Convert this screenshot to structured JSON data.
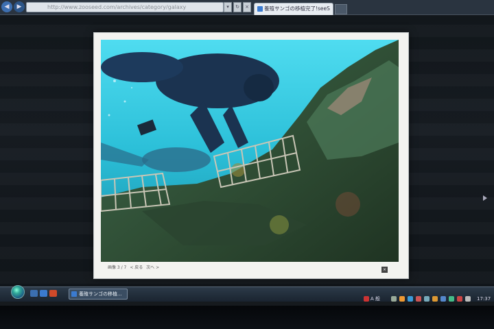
{
  "browser": {
    "address": "http://www.zooseed.com/archives/category/galaxy",
    "back_icon": "back-arrow-icon",
    "forward_icon": "forward-arrow-icon",
    "refresh_label": "↻",
    "stop_label": "×",
    "tab_title": "養殖サンゴの移植完了!seeS"
  },
  "lightbox": {
    "counter": "画像 3 / 7",
    "prev_label": "< 戻る",
    "next_label": "次へ >",
    "close_label": "×"
  },
  "taskbar": {
    "task_title": "養殖サンゴの移植...",
    "input_lang": "A 般",
    "clock": "17:37"
  },
  "colors": {
    "water": "#34c6e0",
    "lightbox_frame": "#f3f3f0",
    "taskbar": "#2c3a48"
  }
}
